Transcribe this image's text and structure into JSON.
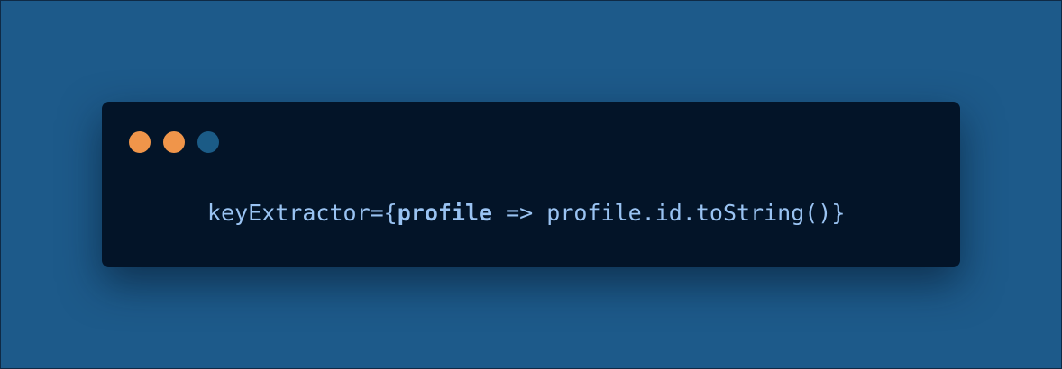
{
  "window": {
    "controls": [
      "dot-orange",
      "dot-orange",
      "dot-blue"
    ]
  },
  "code": {
    "prefix": "keyExtractor={",
    "param": "profile",
    "rest": " => profile.id.toString()}"
  },
  "colors": {
    "background": "#1d5a8a",
    "window_bg": "#031428",
    "code_text": "#9ac3f2",
    "dot_orange": "#f0954a",
    "dot_blue": "#1b5b86"
  }
}
